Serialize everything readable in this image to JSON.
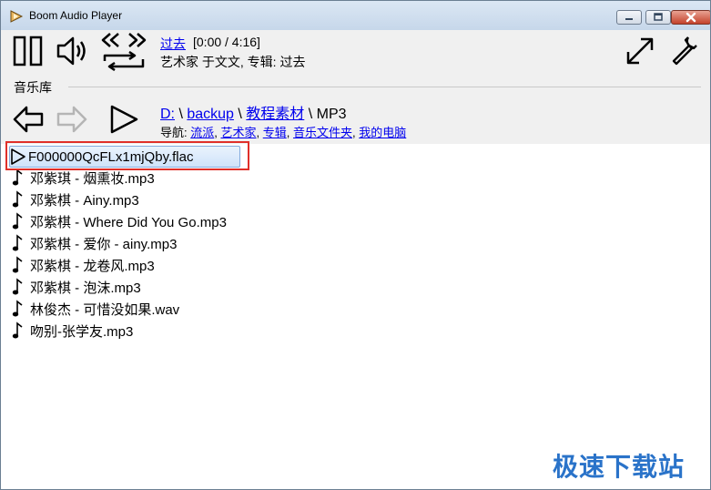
{
  "window": {
    "title": "Boom Audio Player"
  },
  "player": {
    "track_title": "过去",
    "time_display": "[0:00 / 4:16]",
    "meta": "艺术家 于文文, 专辑: 过去"
  },
  "library": {
    "section_label": "音乐库",
    "path": {
      "drive": "D:",
      "sep1": " \\ ",
      "folder1": "backup",
      "sep2": " \\ ",
      "folder2": "教程素材",
      "sep3": " \\ ",
      "current": "MP3"
    },
    "nav": {
      "prefix": "导航: ",
      "items": [
        "流派",
        "艺术家",
        "专辑",
        "音乐文件夹",
        "我的电脑"
      ],
      "sep": ", "
    }
  },
  "files": [
    "F000000QcFLx1mjQby.flac",
    "邓紫琪 - 烟熏妆.mp3",
    "邓紫棋 - Ainy.mp3",
    "邓紫棋 - Where Did You Go.mp3",
    "邓紫棋 - 爱你 - ainy.mp3",
    "邓紫棋 - 龙卷风.mp3",
    "邓紫棋 - 泡沫.mp3",
    "林俊杰 - 可惜没如果.wav",
    "吻别-张学友.mp3"
  ],
  "watermark": "极速下载站",
  "colors": {
    "link": "#0000ee",
    "selection": "#cfe3fa",
    "highlight": "#e0302a",
    "watermark": "#2a73c9"
  },
  "icons": [
    "app-icon",
    "pause-icon",
    "volume-icon",
    "previous-next-icon",
    "repeat-icon",
    "fullscreen-icon",
    "settings-icon",
    "back-icon",
    "forward-icon",
    "play-icon",
    "music-note-icon"
  ]
}
